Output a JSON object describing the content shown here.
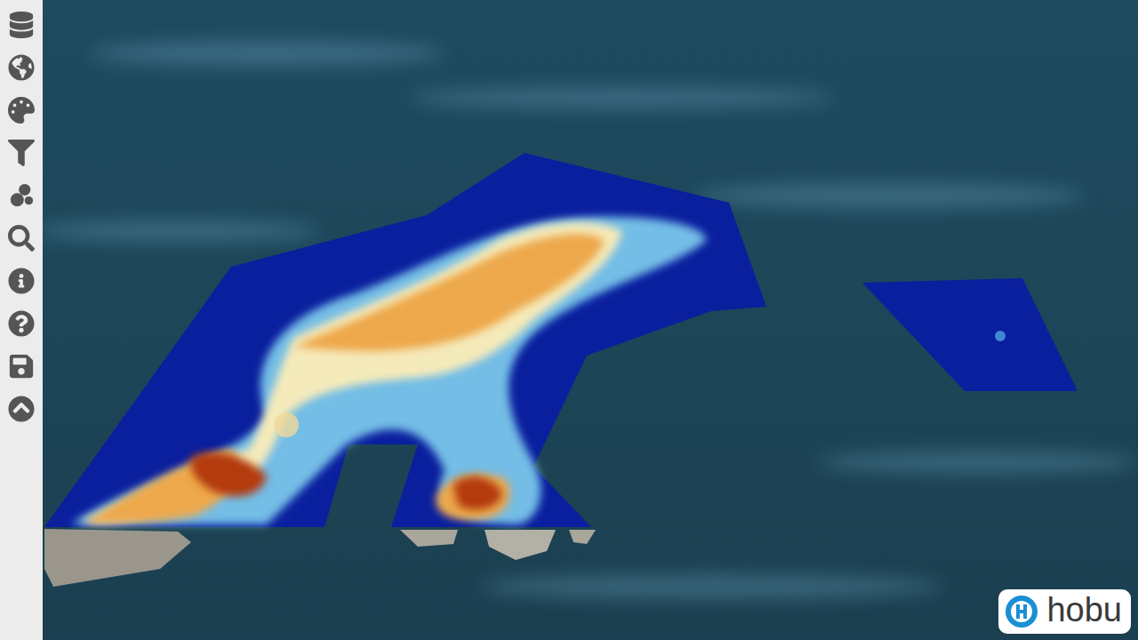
{
  "map": {
    "logo": {
      "label": "hobu"
    }
  }
}
